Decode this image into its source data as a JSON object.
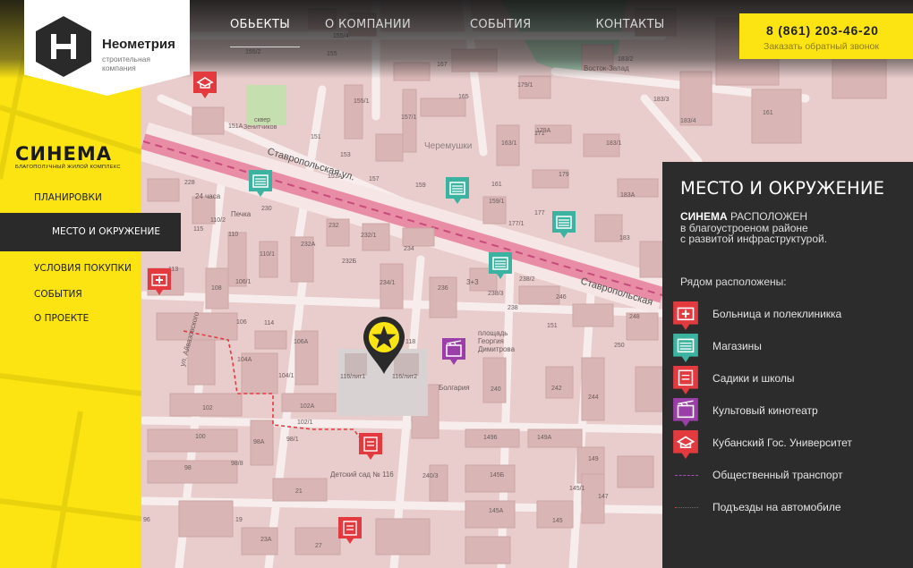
{
  "header": {
    "brand_name": "Неометрия",
    "brand_sub_line1": "строительная",
    "brand_sub_line2": "компания",
    "nav": [
      {
        "label": "ОБЬЕКТЫ",
        "active": true
      },
      {
        "label": "О КОМПАНИИ",
        "active": false
      },
      {
        "label": "СОБЫТИЯ",
        "active": false
      },
      {
        "label": "КОНТАКТЫ",
        "active": false
      }
    ],
    "phone": "8 (861) 203-46-20",
    "callback": "Заказать обратный звонок"
  },
  "sidebar": {
    "project_logo": "СИНЕМА",
    "project_tagline": "благополучный жилой комплекс",
    "items": [
      {
        "label": "ПЛАНИРОВКИ"
      },
      {
        "label": "МЕСТО И ОКРУЖЕНИЕ",
        "active": true
      },
      {
        "label": "УСЛОВИЯ ПОКУПКИ"
      },
      {
        "label": "СОБЫТИЯ"
      },
      {
        "label": "О ПРОЕКТЕ"
      }
    ]
  },
  "info_panel": {
    "title": "МЕСТО И ОКРУЖЕНИЕ",
    "desc_brand": "СИНЕМА",
    "desc_line1": " РАСПОЛОЖЕН",
    "desc_line2": "в благоустроеном районе",
    "desc_line3": "с развитой инфраструктурой.",
    "nearby_title": "Рядом расположены:",
    "legend": [
      {
        "label": "Больница и полеклиникка",
        "icon": "hospital-icon",
        "color": "#e23a3f"
      },
      {
        "label": "Магазины",
        "icon": "shop-icon",
        "color": "#3bb3a0"
      },
      {
        "label": "Садики и школы",
        "icon": "school-icon",
        "color": "#e23a3f"
      },
      {
        "label": "Культовый кинотеатр",
        "icon": "cinema-icon",
        "color": "#9b3fa8"
      },
      {
        "label": "Кубанский Гос. Университет",
        "icon": "university-icon",
        "color": "#e23a3f"
      },
      {
        "label": "Общественный транспорт",
        "icon": "transport-line",
        "color": "#a14fb5"
      },
      {
        "label": "Подъезды на автомобиле",
        "icon": "car-route-line",
        "color": "#e23a3f"
      }
    ]
  },
  "map": {
    "street_1": "Ставропольская ул.",
    "street_2": "Ставропольская",
    "street_3": "ул. Айвазовского",
    "district": "Черемушки",
    "park": "сквер Зенитчиков",
    "square": "площадь Георгия Димитрова",
    "cinema": "Болгария",
    "kindergarten": "Детский сад № 116",
    "store_24": "24 часа",
    "pechka": "Печка",
    "cafe": "3+3",
    "vostok": "Восток-Запад",
    "house_labels": [
      "155/4",
      "155/2",
      "167",
      "155/1",
      "155",
      "157/1",
      "157",
      "153",
      "153А",
      "159",
      "159/1",
      "161",
      "163/1",
      "163",
      "165",
      "171",
      "177",
      "177/1",
      "179",
      "179А",
      "181",
      "183",
      "183А",
      "183/1",
      "183/2",
      "183/3",
      "183/4",
      "183/1",
      "185",
      "161",
      "151А",
      "151",
      "228",
      "230",
      "232",
      "232/1",
      "232А",
      "232Б",
      "234",
      "234/1",
      "236",
      "238",
      "238/3",
      "238/2",
      "240",
      "242",
      "244",
      "246",
      "248",
      "250",
      "110",
      "110/1",
      "110/2",
      "106",
      "106/1",
      "106А",
      "108",
      "104",
      "104/1",
      "104А",
      "102",
      "102А",
      "102/1",
      "100",
      "98",
      "98А",
      "98/8",
      "98/1",
      "96",
      "21",
      "19",
      "23А",
      "27",
      "115",
      "113",
      "114",
      "116/лит1",
      "116/лит2",
      "118",
      "1496",
      "149А",
      "149",
      "145Б",
      "145А",
      "145/1",
      "145",
      "147",
      "151",
      "240/3"
    ]
  }
}
